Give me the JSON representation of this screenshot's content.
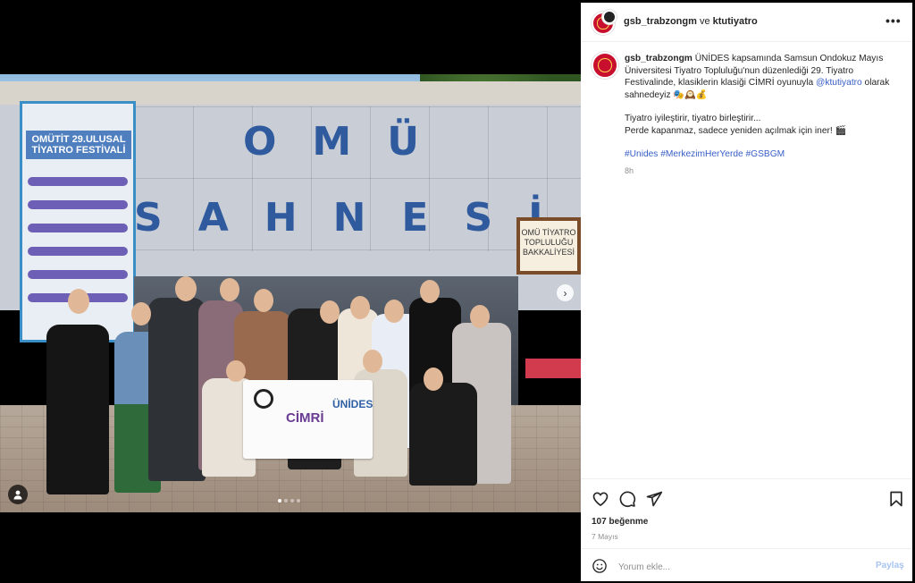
{
  "post": {
    "header": {
      "user1": "gsb_trabzongm",
      "conj": " ve ",
      "user2": "ktutiyatro",
      "more": "•••"
    },
    "caption": {
      "username": "gsb_trabzongm",
      "text1": " ÜNİDES kapsamında Samsun Ondokuz Mayıs Üniversitesi Tiyatro Topluluğu'nun düzenlediği 29. Tiyatro Festivalinde, klasiklerin klasiği CİMRİ oyunuyla ",
      "mention": "@ktutiyatro",
      "text2": " olarak sahnedeyiz 🎭🕰️💰",
      "line2": "Tiyatro iyileştirir, tiyatro birleştirir...",
      "line3": "Perde kapanmaz, sadece yeniden açılmak için iner! 🎬",
      "hashtags": "#Unides #MerkezimHerYerde #GSBGM",
      "time": "8h"
    },
    "likes": "107 beğenme",
    "date": "7 Mayıs",
    "comment": {
      "placeholder": "Yorum ekle...",
      "post_label": "Paylaş"
    },
    "icons": {
      "like": "heart-icon",
      "comment": "comment-icon",
      "share": "send-icon",
      "save": "bookmark-icon",
      "emoji": "smiley-icon",
      "next": "chevron-right-icon",
      "tagged": "user-icon"
    },
    "carousel": {
      "count": 4,
      "active": 1
    }
  },
  "photo": {
    "sign_top": "OMÜ",
    "sign_bottom": "SAHNESİ",
    "banner_title": "OMÜTİT 29.ULUSAL TİYATRO FESTİVALİ",
    "shop_sign": "OMÜ TİYATRO TOPLULUĞU BAKKALİYESİ",
    "held_banner_main": "CİMRİ",
    "held_banner_brand": "ÜNİDES"
  },
  "colors": {
    "link": "#385ec7",
    "avatar": "#c8102e",
    "post_button": "#a7c4f2"
  }
}
